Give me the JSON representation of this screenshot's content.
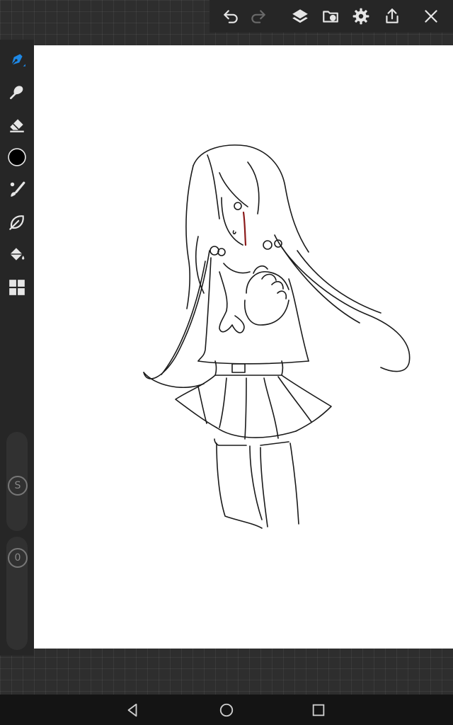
{
  "app": {
    "accent_color": "#1e88e5",
    "toolbar_icon_color": "#e6e6e6",
    "inactive_icon_color": "#6a6a6a"
  },
  "top_toolbar": {
    "buttons": [
      {
        "icon": "undo-icon"
      },
      {
        "icon": "redo-icon",
        "enabled": false
      },
      {
        "icon": "layers-icon"
      },
      {
        "icon": "gallery-icon"
      },
      {
        "icon": "gear-icon"
      },
      {
        "icon": "share-icon"
      },
      {
        "icon": "close-icon"
      }
    ]
  },
  "left_toolbar": {
    "tools": [
      {
        "icon": "pen-icon",
        "selected": true
      },
      {
        "icon": "smudge-icon"
      },
      {
        "icon": "eraser-icon"
      },
      {
        "icon": "color-swatch-icon",
        "color": "#000000"
      },
      {
        "icon": "brush-icon"
      },
      {
        "icon": "leaf-icon"
      },
      {
        "icon": "paint-bucket-icon"
      },
      {
        "icon": "grid-icon"
      }
    ],
    "size_slider": {
      "label": "S"
    },
    "opacity_slider": {
      "label": "0"
    }
  },
  "canvas": {
    "background": "#ffffff",
    "stroke_color": "#1a1a1a",
    "blood_color": "#8b1a1a"
  },
  "system_nav": {
    "buttons": [
      "back-icon",
      "home-icon",
      "recents-icon"
    ]
  }
}
